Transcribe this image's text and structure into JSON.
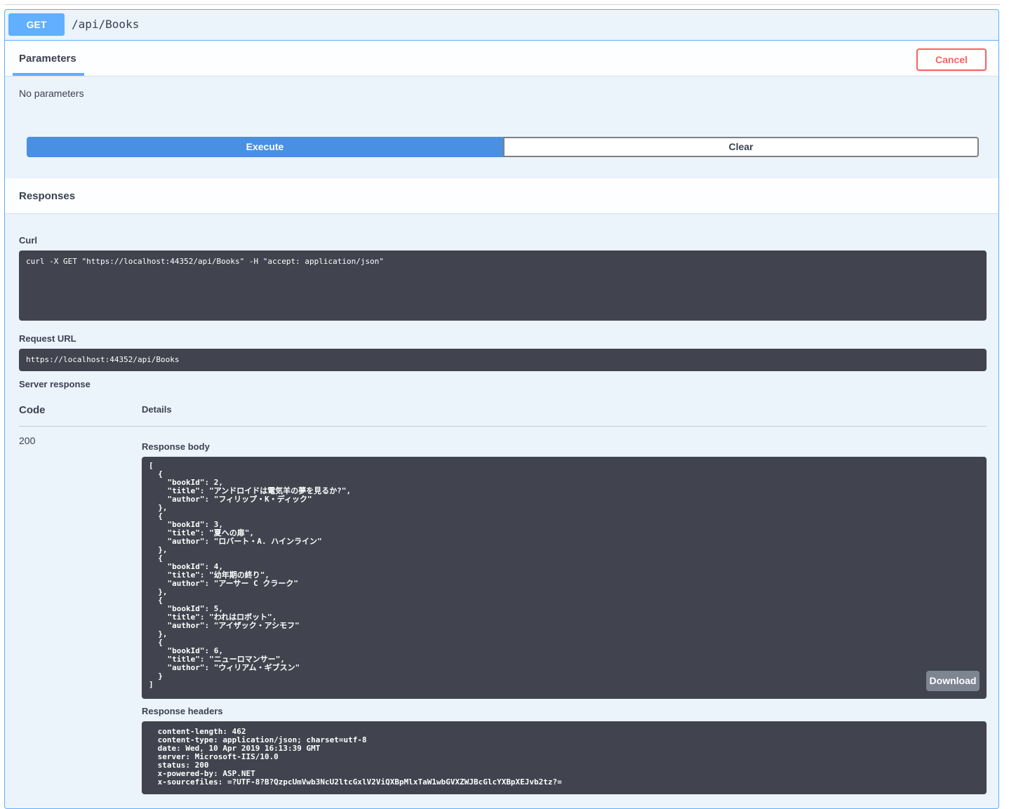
{
  "operation": {
    "method": "GET",
    "path": "/api/Books"
  },
  "parameters": {
    "tab_label": "Parameters",
    "cancel_label": "Cancel",
    "empty_text": "No parameters"
  },
  "actions": {
    "execute_label": "Execute",
    "clear_label": "Clear"
  },
  "responses": {
    "title": "Responses",
    "curl_label": "Curl",
    "curl_command": "curl -X GET \"https://localhost:44352/api/Books\" -H \"accept: application/json\"",
    "request_url_label": "Request URL",
    "request_url": "https://localhost:44352/api/Books",
    "server_response_label": "Server response",
    "code_header": "Code",
    "details_header": "Details",
    "status_code": "200",
    "response_body_label": "Response body",
    "response_body": "[\n  {\n    \"bookId\": 2,\n    \"title\": \"アンドロイドは電気羊の夢を見るか?\",\n    \"author\": \"フィリップ・K・ディック\"\n  },\n  {\n    \"bookId\": 3,\n    \"title\": \"夏への扉\",\n    \"author\": \"ロバート・A. ハインライン\"\n  },\n  {\n    \"bookId\": 4,\n    \"title\": \"幼年期の終り\",\n    \"author\": \"アーサー C クラーク\"\n  },\n  {\n    \"bookId\": 5,\n    \"title\": \"われはロボット\",\n    \"author\": \"アイザック・アシモフ\"\n  },\n  {\n    \"bookId\": 6,\n    \"title\": \"ニューロマンサー\",\n    \"author\": \"ウィリアム・ギブスン\"\n  }\n]",
    "download_label": "Download",
    "response_headers_label": "Response headers",
    "response_headers": " content-length: 462 \n content-type: application/json; charset=utf-8 \n date: Wed, 10 Apr 2019 16:13:39 GMT \n server: Microsoft-IIS/10.0 \n status: 200 \n x-powered-by: ASP.NET \n x-sourcefiles: =?UTF-8?B?QzpcUmVwb3NcU2ltcGxlV2ViQXBpMlxTaW1wbGVXZWJBcGlcYXBpXEJvb2tz?= "
  },
  "colors": {
    "get_accent": "#61affe",
    "execute_blue": "#4990e2",
    "cancel_red": "#ff6060",
    "code_bg": "#41444e"
  }
}
